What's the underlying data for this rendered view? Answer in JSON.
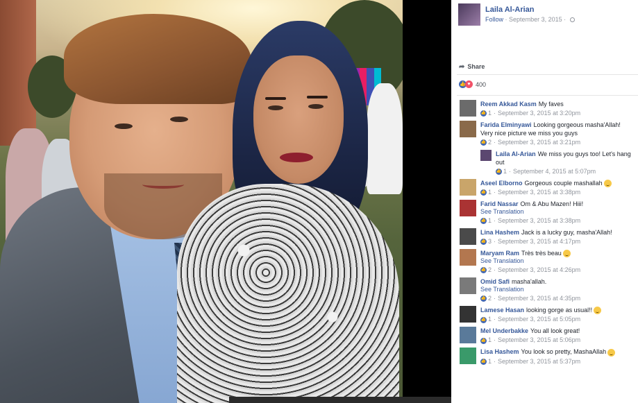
{
  "post": {
    "author": "Laila Al-Arian",
    "follow_label": "Follow",
    "separator": "·",
    "date": "September 3, 2015",
    "share_label": "Share",
    "reaction_count": "400",
    "icons": {
      "like": "thumbs-up-icon",
      "love": "heart-icon",
      "share": "share-arrow-icon",
      "privacy": "globe-icon"
    }
  },
  "comments": [
    {
      "name": "Reem Akkad Kasm",
      "text": "My faves",
      "likes": "1",
      "time": "September 3, 2015 at 3:20pm",
      "translate": "",
      "emoji": false,
      "reply": false,
      "avatar_color": "#6b6b6b"
    },
    {
      "name": "Farida Elminyawi",
      "text": "Looking gorgeous masha'Allah! Very nice picture we miss you guys",
      "likes": "2",
      "time": "September 3, 2015 at 3:21pm",
      "translate": "",
      "emoji": false,
      "reply": false,
      "avatar_color": "#8a6a4a"
    },
    {
      "name": "Laila Al-Arian",
      "text": "We miss you guys too! Let's hang out",
      "likes": "1",
      "time": "September 4, 2015 at 5:07pm",
      "translate": "",
      "emoji": false,
      "reply": true,
      "avatar_color": "#5b4770"
    },
    {
      "name": "Aseel Elborno",
      "text": "Gorgeous couple mashallah",
      "likes": "1",
      "time": "September 3, 2015 at 3:38pm",
      "translate": "",
      "emoji": true,
      "reply": false,
      "avatar_color": "#c9a56a"
    },
    {
      "name": "Farid Nassar",
      "text": "Om & Abu Mazen! Hiii!",
      "likes": "1",
      "time": "September 3, 2015 at 3:38pm",
      "translate": "See Translation",
      "emoji": false,
      "reply": false,
      "avatar_color": "#a33"
    },
    {
      "name": "Lina Hashem",
      "text": "Jack is a lucky guy, masha'Allah!",
      "likes": "3",
      "time": "September 3, 2015 at 4:17pm",
      "translate": "",
      "emoji": false,
      "reply": false,
      "avatar_color": "#4a4a4a"
    },
    {
      "name": "Maryam Ram",
      "text": "Très très beau",
      "likes": "2",
      "time": "September 3, 2015 at 4:26pm",
      "translate": "See Translation",
      "emoji": true,
      "reply": false,
      "avatar_color": "#b3774f"
    },
    {
      "name": "Omid Safi",
      "text": "masha'allah.",
      "likes": "2",
      "time": "September 3, 2015 at 4:35pm",
      "translate": "See Translation",
      "emoji": false,
      "reply": false,
      "avatar_color": "#7a7a7a"
    },
    {
      "name": "Lamese Hasan",
      "text": "looking gorge as usual!!",
      "likes": "1",
      "time": "September 3, 2015 at 5:05pm",
      "translate": "",
      "emoji": true,
      "reply": false,
      "avatar_color": "#333"
    },
    {
      "name": "Mel Underbakke",
      "text": "You all look great!",
      "likes": "1",
      "time": "September 3, 2015 at 5:06pm",
      "translate": "",
      "emoji": false,
      "reply": false,
      "avatar_color": "#5a7a9a"
    },
    {
      "name": "Lisa Hashem",
      "text": "You look so pretty, MashaAllah",
      "likes": "1",
      "time": "September 3, 2015 at 5:37pm",
      "translate": "",
      "emoji": true,
      "reply": false,
      "avatar_color": "#3a9a6a"
    }
  ]
}
